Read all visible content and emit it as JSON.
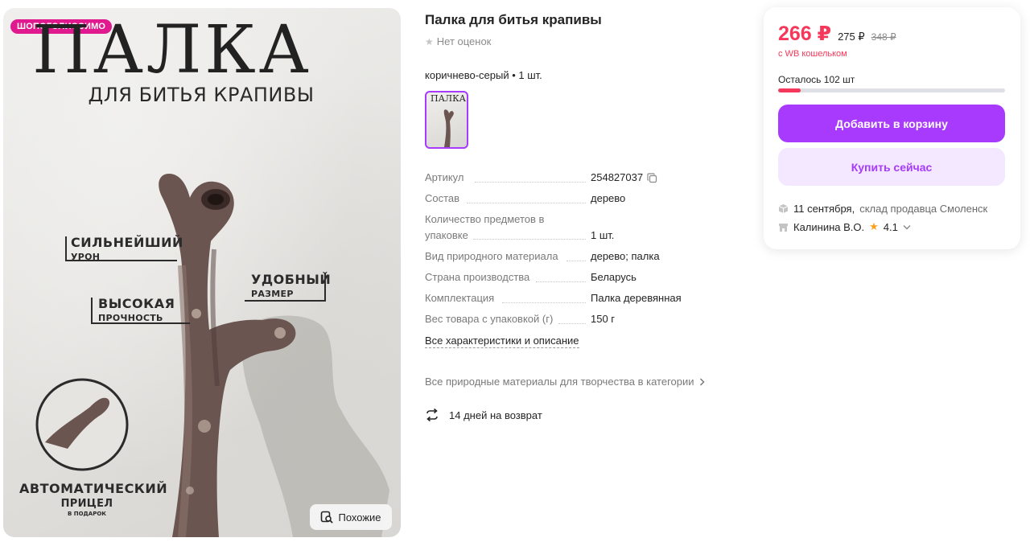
{
  "gallery": {
    "badge": "ШОПОГОЛИССИМО",
    "hero_title": "ПАЛКА",
    "hero_subtitle": "ДЛЯ БИТЬЯ КРАПИВЫ",
    "callouts": {
      "damage_big": "СИЛЬНЕЙШИЙ",
      "damage_small": "УРОН",
      "size_big": "УДОБНЫЙ",
      "size_small": "РАЗМЕР",
      "strength_big": "ВЫСОКАЯ",
      "strength_small": "ПРОЧНОСТЬ",
      "aim_big_1": "АВТОМАТИЧЕСКИЙ",
      "aim_big_2": "ПРИЦЕЛ",
      "aim_tiny": "В ПОДАРОК"
    },
    "similar_label": "Похожие"
  },
  "product": {
    "title": "Палка для битья крапивы",
    "rating_text": "Нет оценок",
    "variant": "коричнево-серый • 1 шт.",
    "thumb_text": "ПАЛКА"
  },
  "specs": [
    {
      "key": "Артикул",
      "value": "254827037"
    },
    {
      "key": "Состав",
      "value": "дерево"
    },
    {
      "key_line1": "Количество предметов в",
      "key_line2": "упаковке",
      "value": "1 шт."
    },
    {
      "key": "Вид природного материала",
      "value": "дерево; палка"
    },
    {
      "key": "Страна производства",
      "value": "Беларусь"
    },
    {
      "key": "Комплектация",
      "value": "Палка деревянная"
    },
    {
      "key": "Вес товара с упаковкой (г)",
      "value": "150 г"
    }
  ],
  "links": {
    "all_specs": "Все характеристики и описание",
    "category": "Все природные материалы для творчества в категории",
    "returns": "14 дней на возврат"
  },
  "card": {
    "price": "266 ₽",
    "price_old": "275 ₽",
    "price_crossed": "348 ₽",
    "wallet_note": "с WB кошельком",
    "stock_text": "Осталось 102 шт",
    "stock_fraction": 0.1,
    "add_to_cart": "Добавить в корзину",
    "buy_now": "Купить сейчас",
    "delivery_date": "11 сентября,",
    "delivery_place": "склад продавца Смоленск",
    "seller_name": "Калинина В.О.",
    "seller_rating": "4.1"
  },
  "colors": {
    "accent": "#a73afd",
    "price": "#f5385a",
    "badge": "#e0198f"
  }
}
